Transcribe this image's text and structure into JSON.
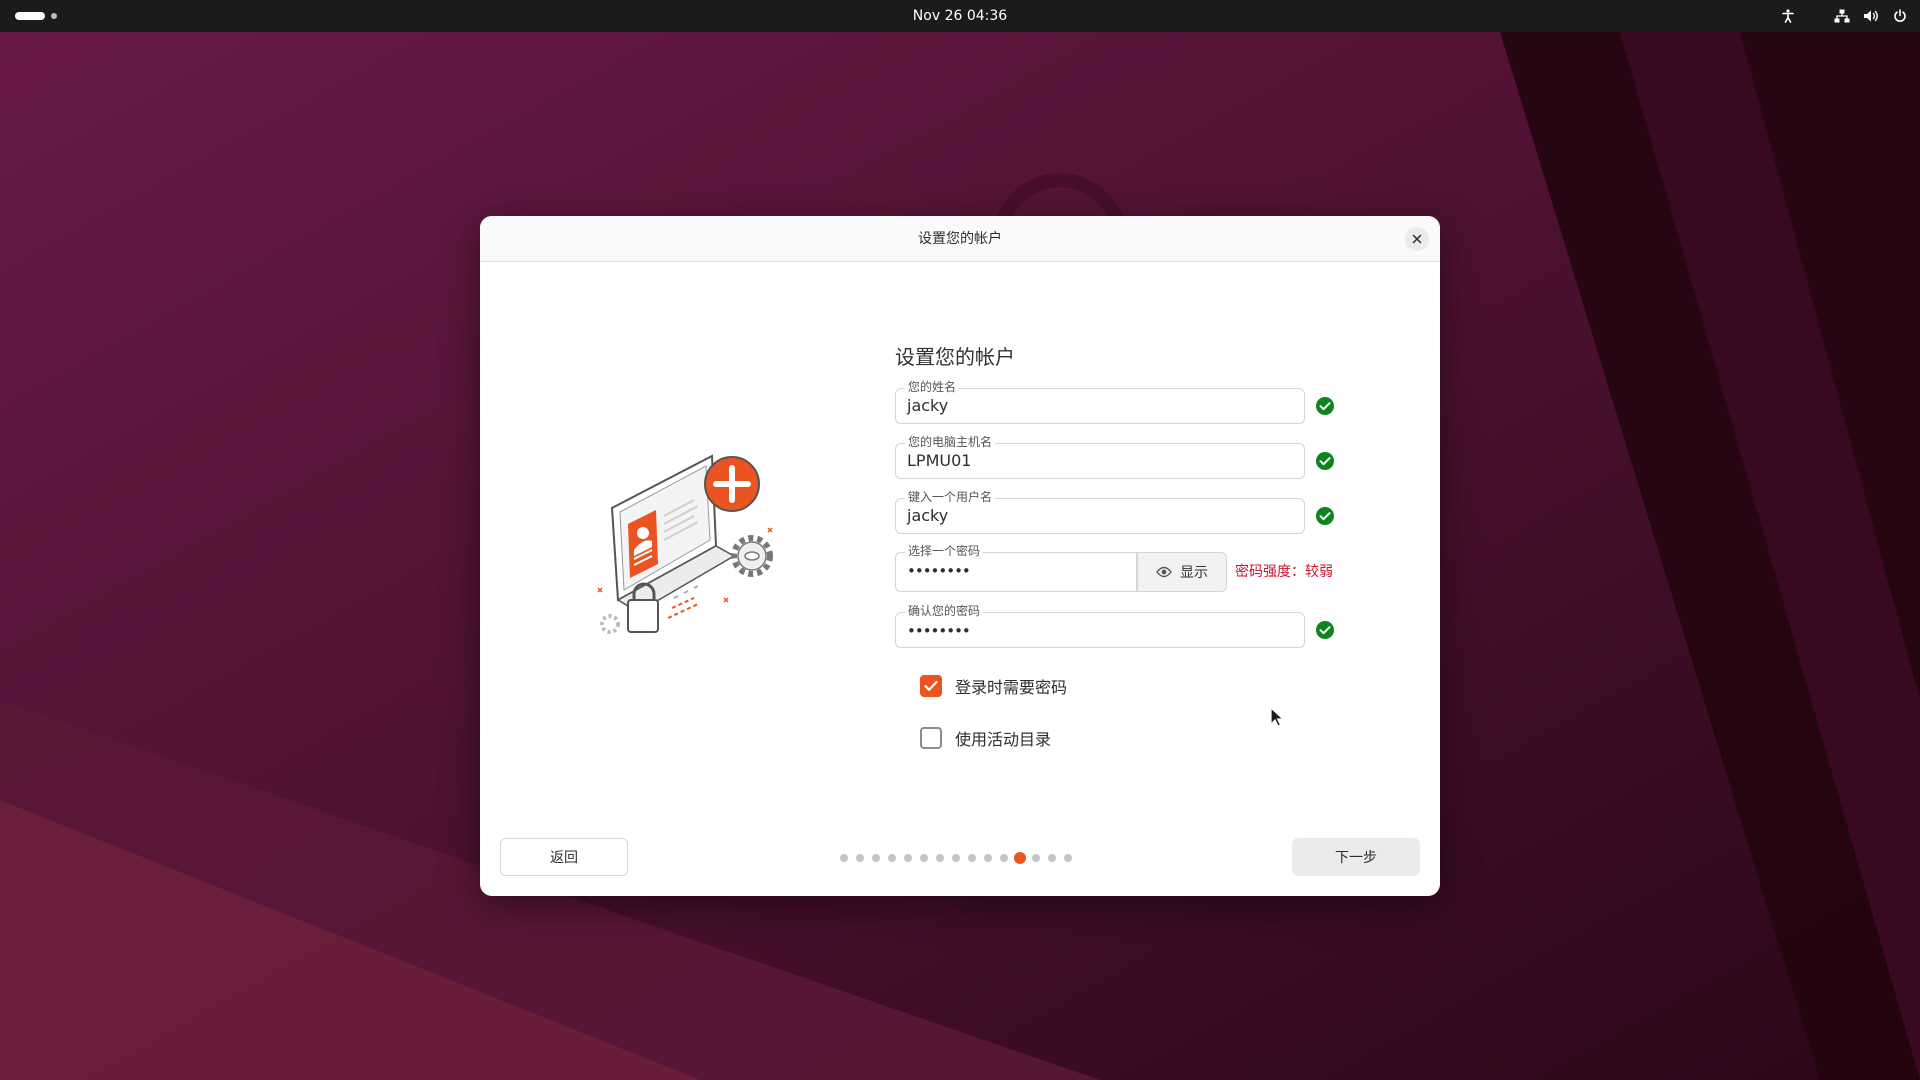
{
  "topbar": {
    "clock": "Nov 26  04:36"
  },
  "dialog": {
    "window_title": "设置您的帐户",
    "heading": "设置您的帐户",
    "fields": {
      "name": {
        "label": "您的姓名",
        "value": "jacky"
      },
      "hostname": {
        "label": "您的电脑主机名",
        "value": "LPMU01"
      },
      "username": {
        "label": "键入一个用户名",
        "value": "jacky"
      },
      "password": {
        "label": "选择一个密码",
        "value": "••••••••"
      },
      "confirm": {
        "label": "确认您的密码",
        "value": "••••••••"
      }
    },
    "show_label": "显示",
    "strength": "密码强度：较弱",
    "require_password": {
      "label": "登录时需要密码",
      "checked": true
    },
    "active_directory": {
      "label": "使用活动目录",
      "checked": false
    },
    "back_label": "返回",
    "next_label": "下一步",
    "steps": {
      "total": 15,
      "current": 12
    }
  },
  "colors": {
    "accent": "#e95420",
    "success": "#0e8420",
    "warning_text": "#c7162b"
  }
}
